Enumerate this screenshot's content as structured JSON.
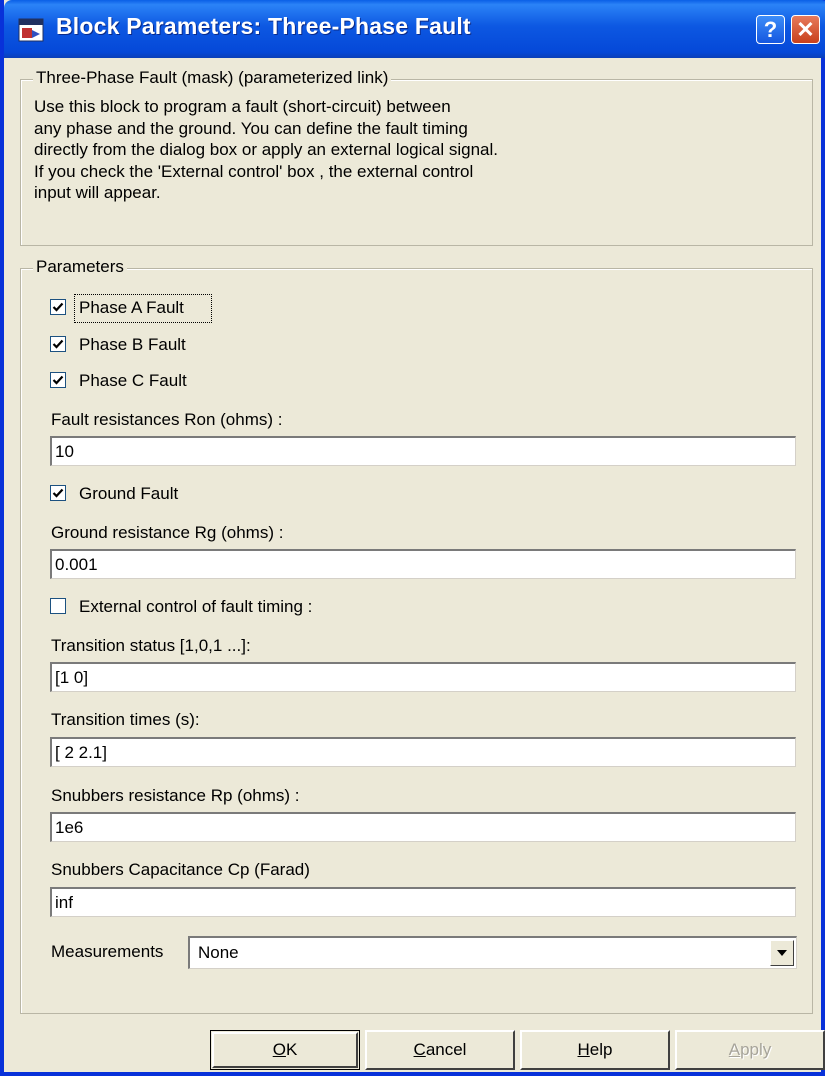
{
  "window": {
    "title": "Block Parameters: Three-Phase Fault",
    "help_glyph": "?",
    "close_glyph": "✕"
  },
  "description_group": {
    "legend": "Three-Phase Fault (mask) (parameterized link)",
    "lines": [
      "Use this block to program a fault (short-circuit) between",
      "any phase and the ground. You can define the fault timing",
      "directly from the dialog box or apply an external logical signal.",
      "If you check the 'External control' box , the external control",
      "input will appear."
    ]
  },
  "parameters": {
    "legend": "Parameters",
    "phase_a": {
      "label": "Phase A Fault",
      "checked": true
    },
    "phase_b": {
      "label": "Phase B Fault",
      "checked": true
    },
    "phase_c": {
      "label": "Phase C Fault",
      "checked": true
    },
    "fault_resistance": {
      "label": "Fault resistances  Ron (ohms) :",
      "value": "10"
    },
    "ground_fault": {
      "label": "Ground Fault",
      "checked": true
    },
    "ground_resistance": {
      "label": "Ground resistance Rg (ohms) :",
      "value": "0.001"
    },
    "external_control": {
      "label": "External control of fault timing :",
      "checked": false
    },
    "transition_status": {
      "label": "Transition status [1,0,1 ...]:",
      "value": "[1 0]"
    },
    "transition_times": {
      "label": "Transition times (s):",
      "value": "[ 2 2.1]"
    },
    "snubber_resistance": {
      "label": "Snubbers resistance Rp (ohms) :",
      "value": "1e6"
    },
    "snubber_capacitance": {
      "label": "Snubbers Capacitance Cp (Farad)",
      "value": "inf"
    },
    "measurements": {
      "label": "Measurements",
      "value": "None"
    }
  },
  "buttons": {
    "ok": {
      "first": "O",
      "rest": "K"
    },
    "cancel": {
      "first": "C",
      "rest": "ancel"
    },
    "help": {
      "first": "H",
      "rest": "elp"
    },
    "apply": {
      "first": "A",
      "rest": "pply"
    }
  },
  "colors": {
    "titlebar": "#0548d8",
    "dialog_bg": "#ece9d8",
    "close_button": "#c8401c",
    "checkbox_border": "#1c5180"
  }
}
